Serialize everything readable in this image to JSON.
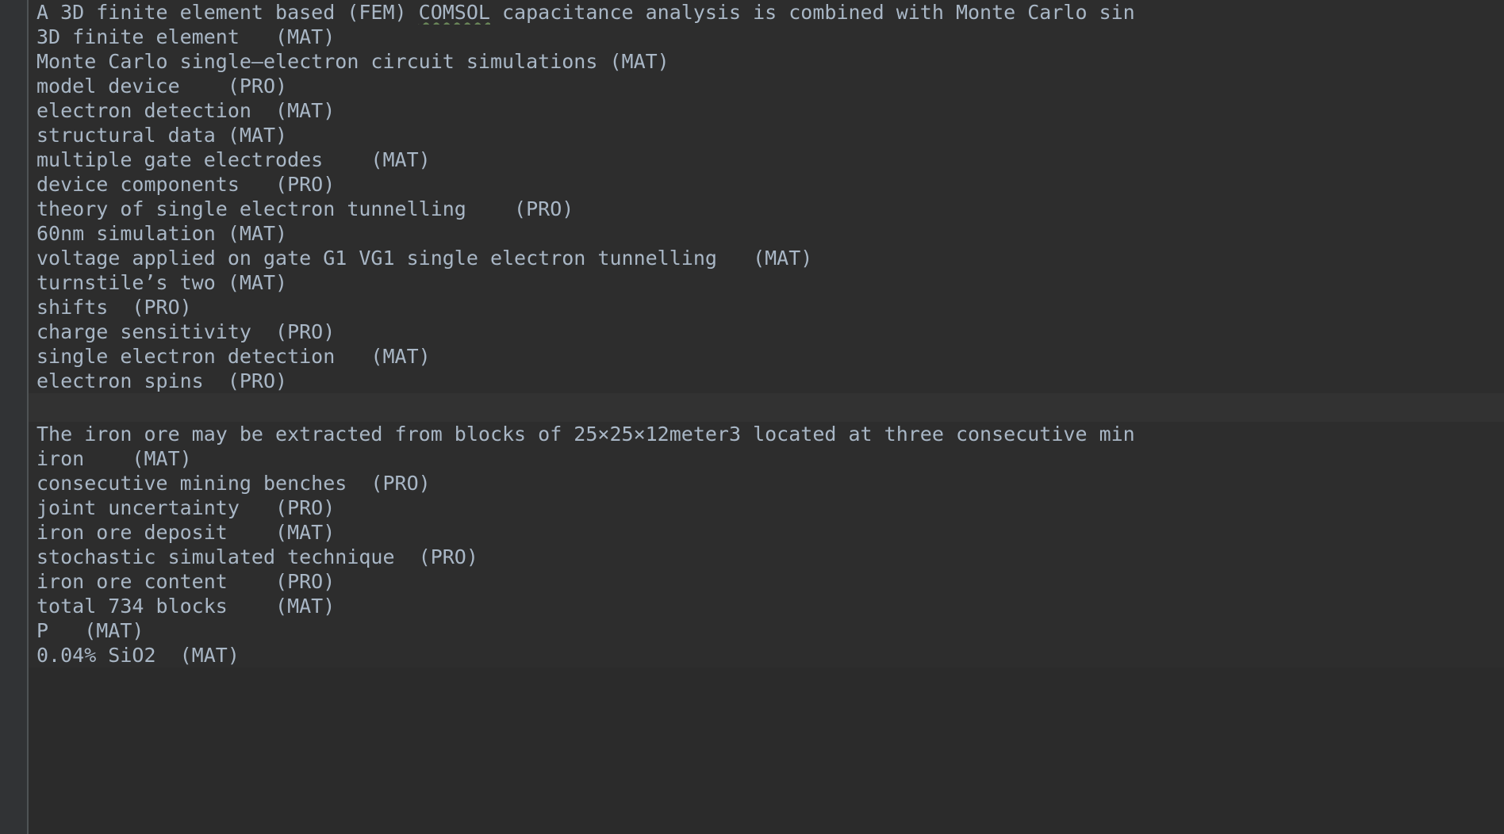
{
  "editor": {
    "theme_name": "darcula",
    "colors": {
      "background": "#2b2b2b",
      "block_background": "#2d2d2d",
      "gap_background": "#323232",
      "gutter": "#313335",
      "gutter_rule": "#4f5355",
      "text": "#a9b7c6",
      "spellcheck_squiggle": "#6a8759"
    }
  },
  "blocks": [
    {
      "id": "block-1",
      "source_line": "A 3D finite element based (FEM) COMSOL capacitance analysis is combined with Monte Carlo sin",
      "source_parts": {
        "before_misspelled": "A 3D finite element based (FEM) ",
        "misspelled": "COMSOL",
        "after_misspelled": " capacitance analysis is combined with Monte Carlo sin"
      },
      "annotations": [
        {
          "term": "3D finite element",
          "label": "(MAT)"
        },
        {
          "term": "Monte Carlo single–electron circuit simulations",
          "label": "(MAT)"
        },
        {
          "term": "model device",
          "label": "(PRO)"
        },
        {
          "term": "electron detection",
          "label": "(MAT)"
        },
        {
          "term": "structural data",
          "label": "(MAT)"
        },
        {
          "term": "multiple gate electrodes",
          "label": "(MAT)"
        },
        {
          "term": "device components",
          "label": "(PRO)"
        },
        {
          "term": "theory of single electron tunnelling",
          "label": "(PRO)"
        },
        {
          "term": "60nm simulation",
          "label": "(MAT)"
        },
        {
          "term": "voltage applied on gate G1 VG1 single electron tunnelling",
          "label": "(MAT)"
        },
        {
          "term": "turnstile’s two",
          "label": "(MAT)"
        },
        {
          "term": "shifts",
          "label": "(PRO)"
        },
        {
          "term": "charge sensitivity",
          "label": "(PRO)"
        },
        {
          "term": "single electron detection",
          "label": "(MAT)"
        },
        {
          "term": "electron spins",
          "label": "(PRO)"
        }
      ],
      "rendered_lines": [
        "3D finite element   (MAT)",
        "Monte Carlo single–electron circuit simulations (MAT)",
        "model device    (PRO)",
        "electron detection  (MAT)",
        "structural data (MAT)",
        "multiple gate electrodes    (MAT)",
        "device components   (PRO)",
        "theory of single electron tunnelling    (PRO)",
        "60nm simulation (MAT)",
        "voltage applied on gate G1 VG1 single electron tunnelling   (MAT)",
        "turnstile’s two (MAT)",
        "shifts  (PRO)",
        "charge sensitivity  (PRO)",
        "single electron detection   (MAT)",
        "electron spins  (PRO)"
      ]
    },
    {
      "id": "block-2",
      "source_line": "The iron ore may be extracted from blocks of 25×25×12meter3 located at three consecutive min",
      "source_parts": {
        "before_misspelled": "The iron ore may be extracted from blocks of 25×25×12meter3 located at three consecutive min",
        "misspelled": "",
        "after_misspelled": ""
      },
      "annotations": [
        {
          "term": "iron",
          "label": "(MAT)"
        },
        {
          "term": "consecutive mining benches",
          "label": "(PRO)"
        },
        {
          "term": "joint uncertainty",
          "label": "(PRO)"
        },
        {
          "term": "iron ore deposit",
          "label": "(MAT)"
        },
        {
          "term": "stochastic simulated technique",
          "label": "(PRO)"
        },
        {
          "term": "iron ore content",
          "label": "(PRO)"
        },
        {
          "term": "total 734 blocks",
          "label": "(MAT)"
        },
        {
          "term": "P",
          "label": "(MAT)"
        },
        {
          "term": "0.04% SiO2",
          "label": "(MAT)"
        }
      ],
      "rendered_lines": [
        "iron    (MAT)",
        "consecutive mining benches  (PRO)",
        "joint uncertainty   (PRO)",
        "iron ore deposit    (MAT)",
        "stochastic simulated technique  (PRO)",
        "iron ore content    (PRO)",
        "total 734 blocks    (MAT)",
        "P   (MAT)",
        "0.04% SiO2  (MAT)"
      ]
    }
  ]
}
